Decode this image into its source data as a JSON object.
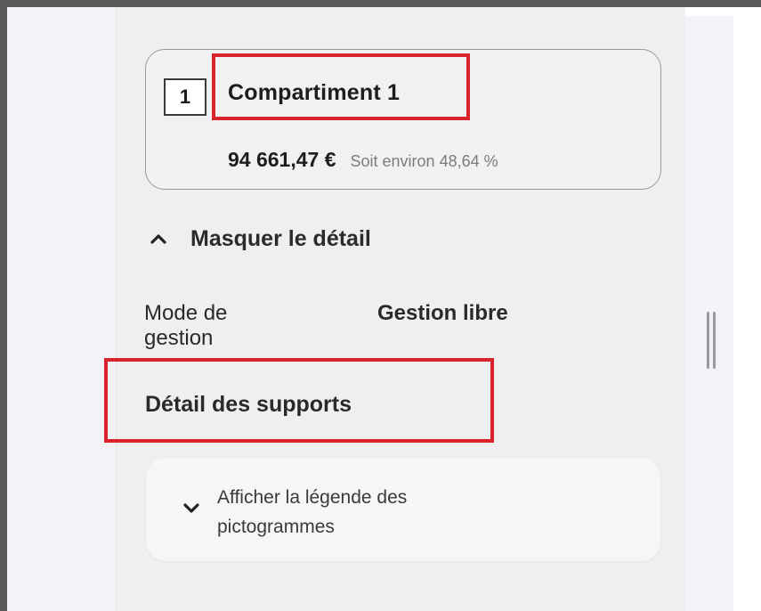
{
  "compartment": {
    "number": "1",
    "title": "Compartiment 1",
    "amount": "94 661,47 €",
    "ratio": "Soit environ 48,64 %"
  },
  "detail_toggle": {
    "label": "Masquer le détail",
    "icon": "chevron-up-icon"
  },
  "management": {
    "label": "Mode de gestion",
    "value": "Gestion libre"
  },
  "supports": {
    "heading": "Détail des supports"
  },
  "legend": {
    "label": "Afficher la légende des pictogrammes",
    "icon": "chevron-down-icon"
  },
  "colors": {
    "highlight": "#d8232a",
    "panel_bg": "#efefef",
    "frame": "#595959"
  }
}
